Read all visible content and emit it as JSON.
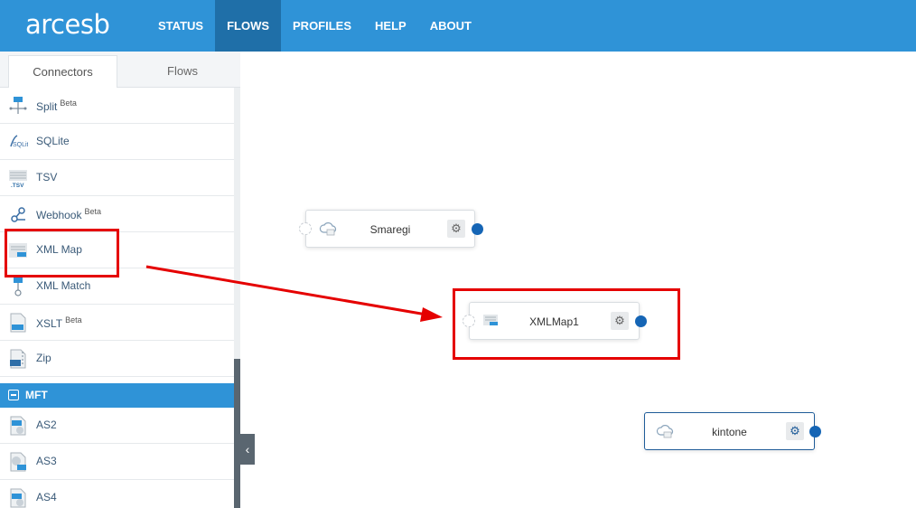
{
  "app": {
    "logo": "arcesb"
  },
  "nav": [
    {
      "label": "STATUS",
      "active": false
    },
    {
      "label": "FLOWS",
      "active": true
    },
    {
      "label": "PROFILES",
      "active": false
    },
    {
      "label": "HELP",
      "active": false
    },
    {
      "label": "ABOUT",
      "active": false
    }
  ],
  "sidebar": {
    "tabs": {
      "connectors": "Connectors",
      "flows": "Flows"
    },
    "items": [
      {
        "label": "Split",
        "beta": "Beta",
        "icon": "split-icon"
      },
      {
        "label": "SQLite",
        "beta": "",
        "icon": "sqlite-icon"
      },
      {
        "label": "TSV",
        "beta": "",
        "icon": "tsv-icon"
      },
      {
        "label": "Webhook",
        "beta": "Beta",
        "icon": "webhook-icon"
      },
      {
        "label": "XML Map",
        "beta": "",
        "icon": "xml-map-icon"
      },
      {
        "label": "XML Match",
        "beta": "",
        "icon": "xml-match-icon"
      },
      {
        "label": "XSLT",
        "beta": "Beta",
        "icon": "xslt-icon"
      },
      {
        "label": "Zip",
        "beta": "",
        "icon": "zip-icon"
      }
    ],
    "section": {
      "label": "MFT"
    },
    "mft_items": [
      {
        "label": "AS2",
        "icon": "as2-icon"
      },
      {
        "label": "AS3",
        "icon": "as3-icon"
      },
      {
        "label": "AS4",
        "icon": "as4-icon"
      }
    ],
    "collapse_glyph": "‹"
  },
  "canvas": {
    "nodes": [
      {
        "label": "Smaregi",
        "icon": "cloud-icon"
      },
      {
        "label": "XMLMap1",
        "icon": "xml-map-icon"
      },
      {
        "label": "kintone",
        "icon": "cloud-icon"
      }
    ],
    "gear_glyph": "⚙"
  },
  "colors": {
    "brand": "#2f93d7",
    "nav_active": "#1f6fa8",
    "port": "#1565b5",
    "highlight": "#e50000"
  }
}
